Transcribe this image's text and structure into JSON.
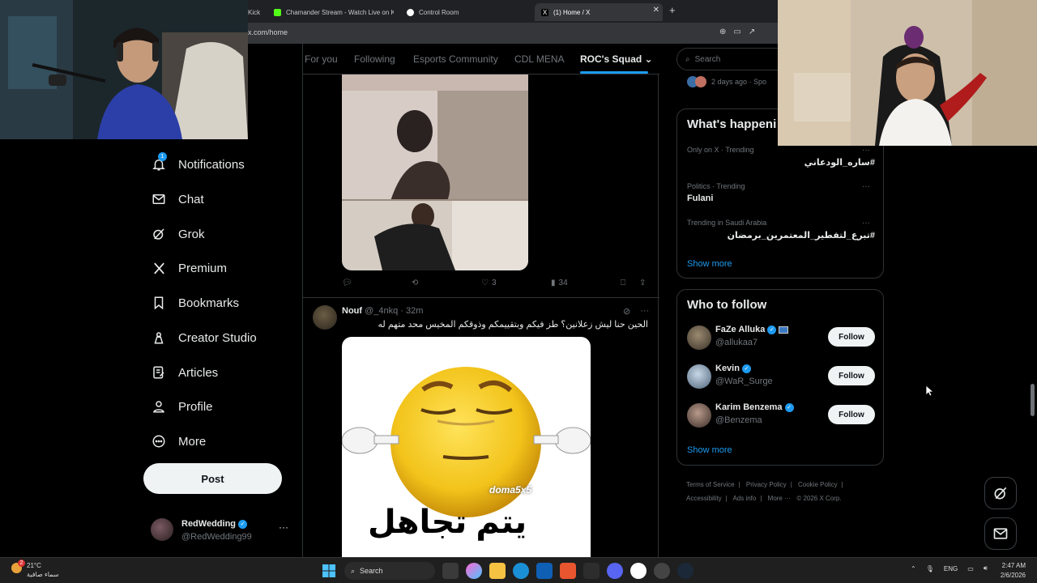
{
  "browser": {
    "tabs": [
      {
        "label": "Kick",
        "active": false
      },
      {
        "label": "Chamander Stream - Watch Live on K",
        "active": false
      },
      {
        "label": "Control Room",
        "active": false
      },
      {
        "label": "(1) Home / X",
        "active": true
      }
    ],
    "new_tab": "+",
    "url": "x.com/home"
  },
  "nav": {
    "items": [
      {
        "label": "Notifications",
        "icon": "bell-icon",
        "badge": "1"
      },
      {
        "label": "Chat",
        "icon": "mail-icon"
      },
      {
        "label": "Grok",
        "icon": "grok-icon"
      },
      {
        "label": "Premium",
        "icon": "x-logo-icon"
      },
      {
        "label": "Bookmarks",
        "icon": "bookmark-icon"
      },
      {
        "label": "Creator Studio",
        "icon": "creator-icon"
      },
      {
        "label": "Articles",
        "icon": "article-icon"
      },
      {
        "label": "Profile",
        "icon": "person-icon"
      },
      {
        "label": "More",
        "icon": "more-circle-icon"
      }
    ],
    "post_label": "Post",
    "account": {
      "name": "RedWedding",
      "handle": "@RedWedding99",
      "more": "···"
    }
  },
  "feed": {
    "tabs": [
      "For you",
      "Following",
      "Esports Community",
      "CDL MENA",
      "ROC's Squad"
    ],
    "active_tab": "ROC's Squad",
    "tweet1": {
      "replies": "",
      "reposts": "",
      "likes": "3",
      "views": "34"
    },
    "tweet2": {
      "name": "Nouf",
      "handle": "@_4nkq",
      "time": "· 32m",
      "text": "الحين حنا ليش زعلانين؟ طز فيكم وبتقييمكم وذوقكم المخيس محد متهم له",
      "watermark": "doma5x5",
      "meme_text": "يتم تجاهل"
    }
  },
  "sidebar": {
    "search_placeholder": "Search",
    "sponsored_meta": "2 days ago · Spo",
    "whats_happening": {
      "title": "What's happeni",
      "trends": [
        {
          "context": "Only on X · Trending",
          "name": "#ساره_الودعاني",
          "rtl": true
        },
        {
          "context": "Politics · Trending",
          "name": "Fulani",
          "rtl": false
        },
        {
          "context": "Trending in Saudi Arabia",
          "name": "#تبرع_لتفطير_المعتمرين_برمضان",
          "rtl": true
        }
      ],
      "show_more": "Show more"
    },
    "who_to_follow": {
      "title": "Who to follow",
      "users": [
        {
          "name": "FaZe Alluka",
          "handle": "@allukaa7",
          "follow": "Follow"
        },
        {
          "name": "Kevin",
          "handle": "@WaR_Surge",
          "follow": "Follow"
        },
        {
          "name": "Karim Benzema",
          "handle": "@Benzema",
          "follow": "Follow"
        }
      ],
      "show_more": "Show more"
    },
    "footer": {
      "line1": [
        "Terms of Service",
        "|",
        "Privacy Policy",
        "|",
        "Cookie Policy",
        "|"
      ],
      "line2": [
        "Accessibility",
        "|",
        "Ads info",
        "|",
        "More ···",
        "© 2026 X Corp."
      ]
    }
  },
  "taskbar": {
    "weather_badge": "2",
    "temperature": "21°C",
    "weather_text": "سماء صافية",
    "search_label": "Search",
    "language": "ENG",
    "time": "2:47 AM",
    "date": "2/6/2026"
  },
  "colors": {
    "accent": "#1d9bf0",
    "background": "#000000",
    "border": "#2f3336",
    "muted": "#71767b"
  }
}
